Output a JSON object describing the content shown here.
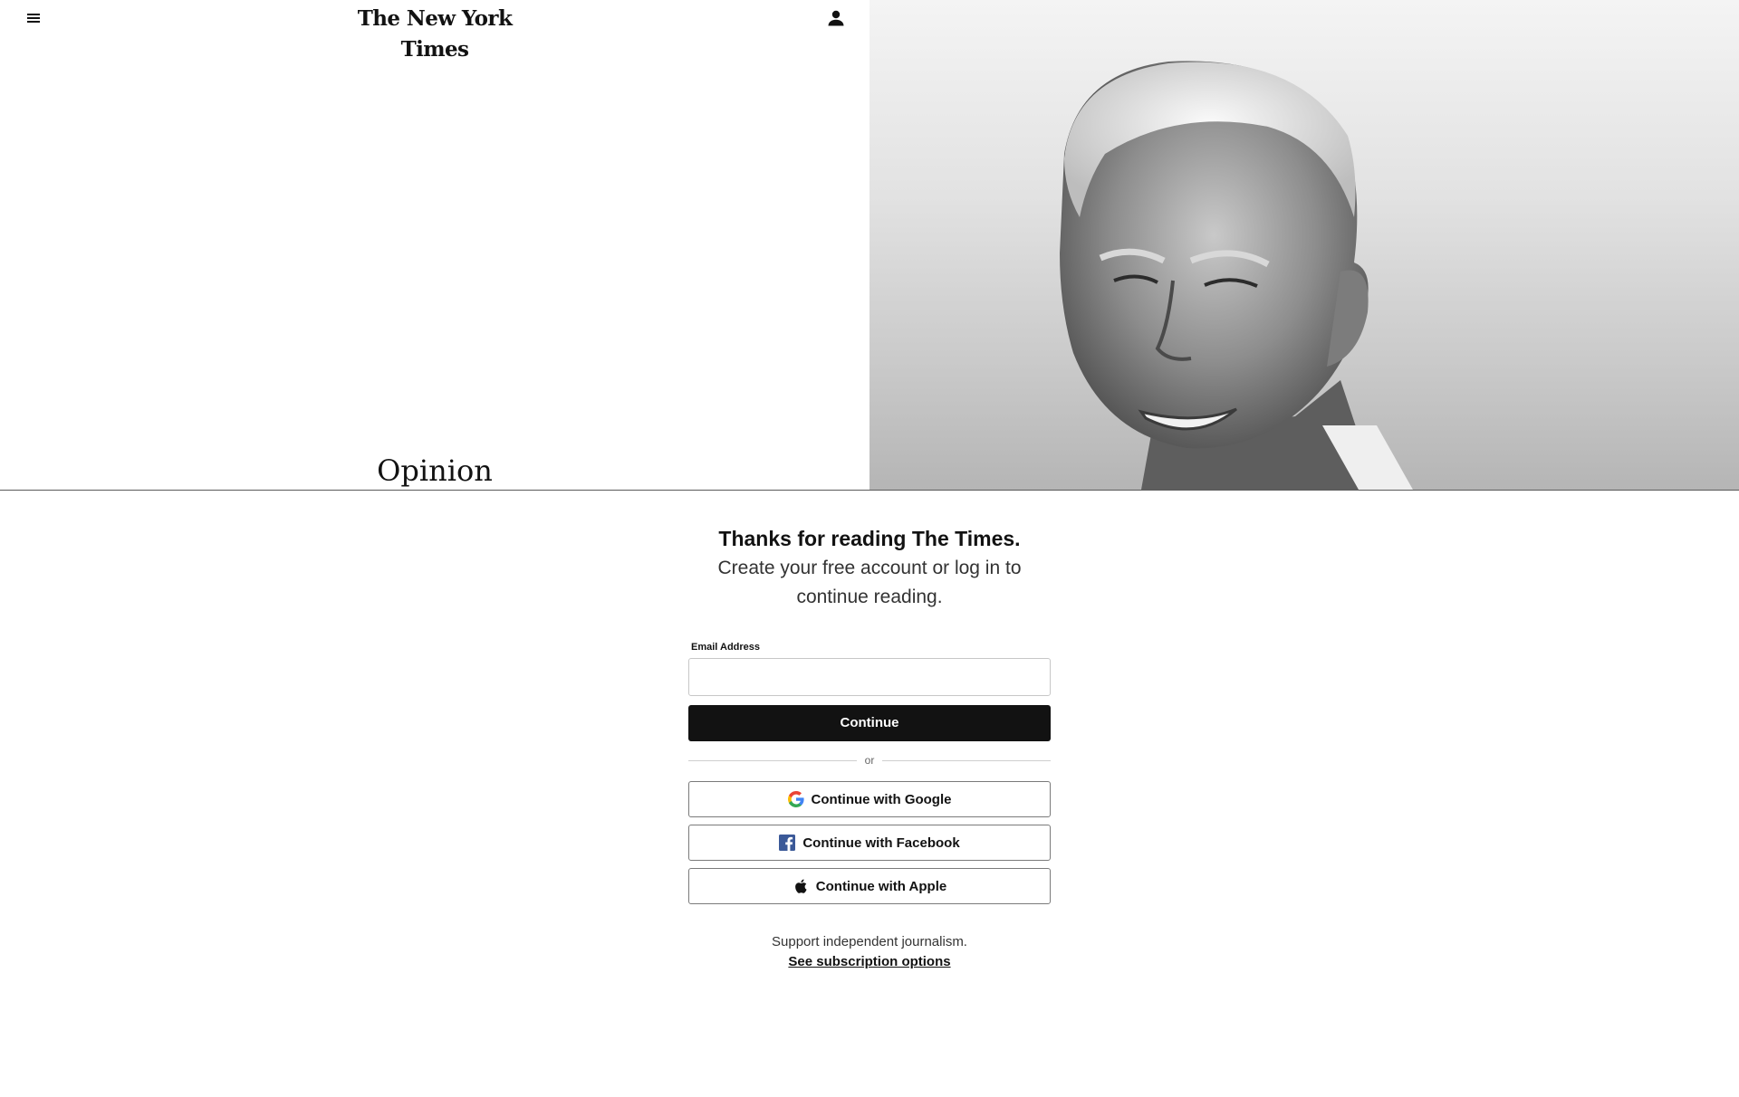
{
  "header": {
    "menu_icon": "hamburger-menu-icon",
    "masthead": "The New York Times",
    "account_icon": "person-icon",
    "section_title": "Opinion"
  },
  "hero": {
    "image_description_icon": "portrait-photo"
  },
  "login": {
    "headline": "Thanks for reading The Times.",
    "subhead_line1": "Create your free account or log in to",
    "subhead_line2": "continue reading.",
    "email_label": "Email Address",
    "email_value": "",
    "continue_label": "Continue",
    "divider_text": "or",
    "google_label": "Continue with Google",
    "facebook_label": "Continue with Facebook",
    "apple_label": "Continue with Apple",
    "support_text": "Support independent journalism.",
    "subscription_link": "See subscription options"
  },
  "colors": {
    "primary": "#121212",
    "background": "#ffffff",
    "facebook": "#3b5998"
  }
}
